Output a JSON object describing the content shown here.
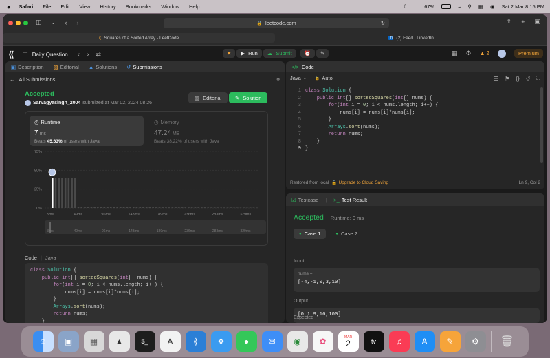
{
  "menubar": {
    "items": [
      "Safari",
      "File",
      "Edit",
      "View",
      "History",
      "Bookmarks",
      "Window",
      "Help"
    ],
    "battery": "67%",
    "datetime": "Sat 2 Mar  8:15 PM"
  },
  "browser": {
    "url": "leetcode.com",
    "tabs": [
      {
        "title": "Squares of a Sorted Array - LeetCode"
      },
      {
        "title": "(2) Feed | LinkedIn",
        "favicon_text": "in"
      }
    ]
  },
  "topbar": {
    "daily_question": "Daily Question",
    "run": "Run",
    "submit": "Submit",
    "streak": "2",
    "premium": "Premium"
  },
  "left_tabs": [
    "Description",
    "Editorial",
    "Solutions",
    "Submissions"
  ],
  "submission": {
    "back_label": "All Submissions",
    "status": "Accepted",
    "user": "Sarvagyasingh_2004",
    "submitted_text": "submitted at Mar 02, 2024 08:26",
    "editorial_btn": "Editorial",
    "solution_btn": "Solution",
    "runtime": {
      "label": "Runtime",
      "value": "7",
      "unit": "ms",
      "beats_prefix": "Beats",
      "beats_pct": "45.63%",
      "beats_suffix": "of users with Java"
    },
    "memory": {
      "label": "Memory",
      "value": "47.24",
      "unit": "MB",
      "beats_prefix": "Beats",
      "beats_pct": "38.22%",
      "beats_suffix": "of users with Java"
    }
  },
  "chart_data": {
    "type": "bar",
    "y_ticks": [
      "75%",
      "50%",
      "25%",
      "0%"
    ],
    "ylim": [
      0,
      75
    ],
    "categories": [
      "3ms",
      "49ms",
      "96ms",
      "143ms",
      "189ms",
      "236ms",
      "283ms",
      "329ms"
    ],
    "highlight_index": 0,
    "highlight_value": 40,
    "values": [
      40,
      1.5,
      1,
      1,
      0.8,
      0.8,
      0.6,
      0.5
    ]
  },
  "left_code": {
    "tab_code": "Code",
    "lang": "Java",
    "lines": [
      [
        {
          "t": "class ",
          "c": "kw"
        },
        {
          "t": "Solution",
          "c": "ty"
        },
        {
          "t": " {",
          "c": "pl"
        }
      ],
      [
        {
          "t": "    public ",
          "c": "kw"
        },
        {
          "t": "int",
          "c": "kw"
        },
        {
          "t": "[] ",
          "c": "pl"
        },
        {
          "t": "sortedSquares",
          "c": "fn"
        },
        {
          "t": "(",
          "c": "pl"
        },
        {
          "t": "int",
          "c": "kw"
        },
        {
          "t": "[] nums) {",
          "c": "pl"
        }
      ],
      [
        {
          "t": "        for",
          "c": "kw"
        },
        {
          "t": "(",
          "c": "pl"
        },
        {
          "t": "int",
          "c": "kw"
        },
        {
          "t": " i = ",
          "c": "pl"
        },
        {
          "t": "0",
          "c": "num"
        },
        {
          "t": "; i < nums.length; i++) {",
          "c": "pl"
        }
      ],
      [
        {
          "t": "            nums[i] = nums[i]*nums[i];",
          "c": "pl"
        }
      ],
      [
        {
          "t": "        }",
          "c": "pl"
        }
      ],
      [
        {
          "t": "        Arrays",
          "c": "ty"
        },
        {
          "t": ".",
          "c": "pl"
        },
        {
          "t": "sort",
          "c": "fn"
        },
        {
          "t": "(nums);",
          "c": "pl"
        }
      ],
      [
        {
          "t": "        return ",
          "c": "kw"
        },
        {
          "t": "nums;",
          "c": "pl"
        }
      ],
      [
        {
          "t": "    }",
          "c": "pl"
        }
      ]
    ]
  },
  "editor": {
    "title": "Code",
    "lang": "Java",
    "auto": "Auto",
    "line_numbers": [
      "1",
      "2",
      "3",
      "4",
      "5",
      "6",
      "7",
      "8",
      "9"
    ],
    "lines": [
      [
        {
          "t": "class ",
          "c": "kw"
        },
        {
          "t": "Solution",
          "c": "ty"
        },
        {
          "t": " {",
          "c": "pl"
        }
      ],
      [
        {
          "t": "    public ",
          "c": "kw"
        },
        {
          "t": "int",
          "c": "kw"
        },
        {
          "t": "[] ",
          "c": "pl"
        },
        {
          "t": "sortedSquares",
          "c": "fn"
        },
        {
          "t": "(",
          "c": "pl"
        },
        {
          "t": "int",
          "c": "kw"
        },
        {
          "t": "[] nums) {",
          "c": "pl"
        }
      ],
      [
        {
          "t": "        for",
          "c": "kw"
        },
        {
          "t": "(",
          "c": "pl"
        },
        {
          "t": "int",
          "c": "kw"
        },
        {
          "t": " i = ",
          "c": "pl"
        },
        {
          "t": "0",
          "c": "num"
        },
        {
          "t": "; i < nums.length; i++) {",
          "c": "pl"
        }
      ],
      [
        {
          "t": "            nums[i] = nums[i]*nums[i];",
          "c": "pl"
        }
      ],
      [
        {
          "t": "        }",
          "c": "pl"
        }
      ],
      [
        {
          "t": "        Arrays",
          "c": "ty"
        },
        {
          "t": ".",
          "c": "pl"
        },
        {
          "t": "sort",
          "c": "fn"
        },
        {
          "t": "(nums);",
          "c": "pl"
        }
      ],
      [
        {
          "t": "        return ",
          "c": "kw"
        },
        {
          "t": "nums;",
          "c": "pl"
        }
      ],
      [
        {
          "t": "    }",
          "c": "pl"
        }
      ],
      [
        {
          "t": "}",
          "c": "pl"
        }
      ]
    ],
    "restored": "Restored from local",
    "upgrade": "Upgrade to Cloud Saving",
    "cursor": "Ln 9, Col 2"
  },
  "testpanel": {
    "tab1": "Testcase",
    "tab2": "Test Result",
    "status": "Accepted",
    "runtime": "Runtime: 0 ms",
    "case1": "Case 1",
    "case2": "Case 2",
    "input_label": "Input",
    "var_label": "nums =",
    "input_value": "[-4,-1,0,3,10]",
    "output_label": "Output",
    "output_value": "[0,1,9,16,100]",
    "expected_label": "Expected"
  },
  "dock": {
    "calendar_month": "MAR",
    "calendar_day": "2",
    "tv": "tv"
  },
  "colors": {
    "accent_green": "#2cbb5d",
    "orange": "#f0a43a",
    "bg": "#1a1a1a",
    "panel": "#262626"
  }
}
